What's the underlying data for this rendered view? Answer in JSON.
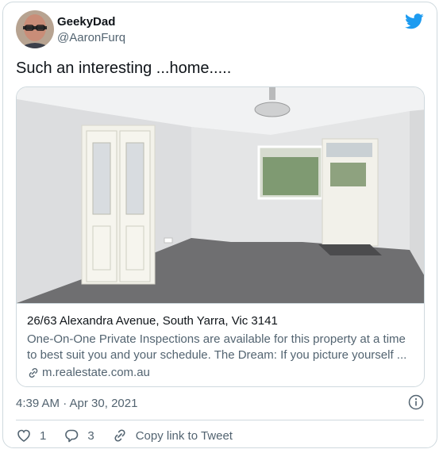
{
  "author": {
    "name": "GeekyDad",
    "handle": "@AaronFurq"
  },
  "tweet": {
    "text": "Such an interesting ...home....."
  },
  "card": {
    "title": "26/63 Alexandra Avenue, South Yarra, Vic 3141",
    "description": "One-On-One Private Inspections are available for this property at a time to best suit you and your schedule. The Dream: If you picture yourself ...",
    "domain": "m.realestate.com.au",
    "image": "empty-room-photo"
  },
  "timestamp": "4:39 AM · Apr 30, 2021",
  "actions": {
    "likes": "1",
    "replies": "3",
    "copy_link": "Copy link to Tweet"
  },
  "icons": {
    "brand": "twitter-bird-icon",
    "info": "info-icon",
    "like": "heart-icon",
    "reply": "reply-icon",
    "link": "link-icon"
  },
  "colors": {
    "brand": "#1d9bf0",
    "text": "#0f1419",
    "secondary": "#536471",
    "border": "#cfd9de"
  }
}
